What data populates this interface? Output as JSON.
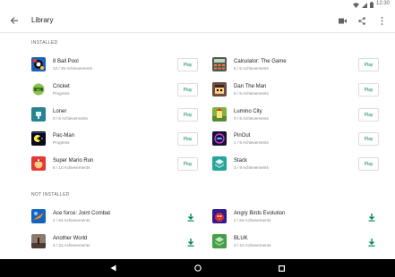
{
  "status_bar": {
    "time": "12:30",
    "icons": [
      "wifi-icon",
      "signal-icon",
      "battery-icon"
    ]
  },
  "app_bar": {
    "title": "Library",
    "actions": [
      "video-camera-icon",
      "share-icon",
      "more-vert-icon"
    ]
  },
  "installed": {
    "header": "INSTALLED",
    "button_label": "Play",
    "left": [
      {
        "name": "8 Ball Pool",
        "sub": "12 / 25 Achievements",
        "icon": "8-ball-pool-icon"
      },
      {
        "name": "Cricket",
        "sub": "Progress",
        "icon": "cricket-icon"
      },
      {
        "name": "Loner",
        "sub": "0 / 5 Achievements",
        "icon": "loner-icon"
      },
      {
        "name": "Pac-Man",
        "sub": "Progress",
        "icon": "pac-man-icon"
      },
      {
        "name": "Super Mario Run",
        "sub": "6 / 10 Achievements",
        "icon": "super-mario-run-icon"
      }
    ],
    "right": [
      {
        "name": "Calculator: The Game",
        "sub": "5 / 5 Achievements",
        "icon": "calculator-game-icon"
      },
      {
        "name": "Dan The Man",
        "sub": "5 / 5 Achievements",
        "icon": "dan-the-man-icon"
      },
      {
        "name": "Lumino City",
        "sub": "0 / 5 Achievements",
        "icon": "lumino-city-icon"
      },
      {
        "name": "PinOut",
        "sub": "1 / 9 Achievements",
        "icon": "pinout-icon"
      },
      {
        "name": "Stack",
        "sub": "3 / 9 Achievements",
        "icon": "stack-icon"
      }
    ]
  },
  "not_installed": {
    "header": "NOT INSTALLED",
    "left": [
      {
        "name": "Ace force: Joint Combat",
        "sub": "2 / 64 Achievements",
        "icon": "ace-force-icon"
      },
      {
        "name": "Another World",
        "sub": "3 / 31 Achievements",
        "icon": "another-world-icon"
      }
    ],
    "right": [
      {
        "name": "Angry Birds Evolution",
        "sub": "2 / 64 Achievements",
        "icon": "angry-birds-evolution-icon"
      },
      {
        "name": "BLUK",
        "sub": "3 / 21 Achievements",
        "icon": "bluk-icon"
      }
    ]
  },
  "nav_bar": [
    "back-triangle-icon",
    "home-circle-icon",
    "recents-square-icon"
  ],
  "colors": {
    "accent": "#01875f",
    "divider": "#e6e6e6",
    "nav_bg": "#000000"
  }
}
